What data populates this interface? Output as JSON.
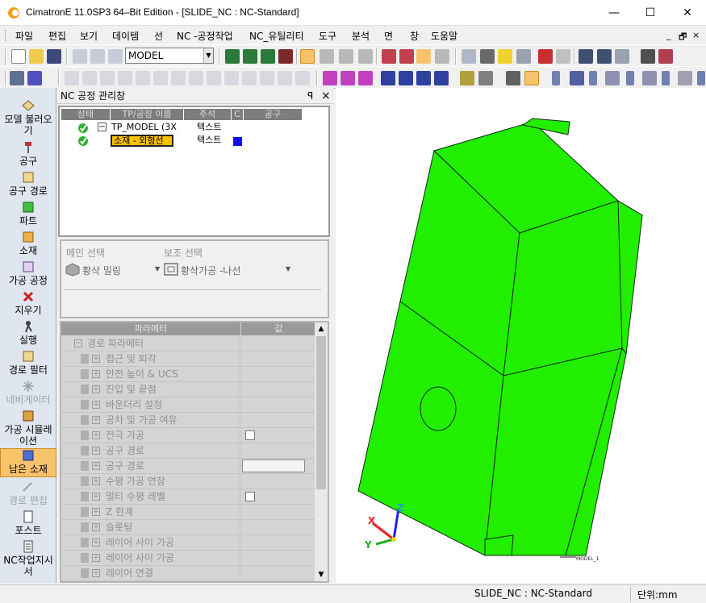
{
  "window": {
    "title": "CimatronE 11.0SP3 64–Bit Edition - [SLIDE_NC : NC-Standard]",
    "min": "—",
    "max": "☐",
    "close": "✕"
  },
  "menu": [
    "파일",
    "편집",
    "보기",
    "데이템",
    "선",
    "NC -공정작업",
    "NC_유틸리티",
    "도구",
    "분석",
    "면",
    "창",
    "도움말"
  ],
  "mdi": {
    "min": "_",
    "restore": "🗗",
    "close": "×"
  },
  "toolbar": {
    "model_combo": "MODEL"
  },
  "sidebar": {
    "items": [
      {
        "label": "모델 불러오기",
        "icon": "load-model-icon"
      },
      {
        "label": "공구",
        "icon": "tool-icon"
      },
      {
        "label": "공구 경로",
        "icon": "toolpath-icon"
      },
      {
        "label": "파트",
        "icon": "part-icon"
      },
      {
        "label": "소재",
        "icon": "stock-icon"
      },
      {
        "label": "가공 공정",
        "icon": "procedure-icon"
      },
      {
        "label": "지우기",
        "icon": "delete-icon"
      },
      {
        "label": "실행",
        "icon": "run-icon"
      },
      {
        "label": "경로 필터",
        "icon": "path-filter-icon"
      },
      {
        "label": "네비게이터",
        "icon": "navigator-icon"
      },
      {
        "label": "가공 시뮬레이션",
        "icon": "simulation-icon"
      },
      {
        "label": "남은 소재",
        "icon": "remaining-stock-icon"
      },
      {
        "label": "경로 편집",
        "icon": "edit-path-icon"
      },
      {
        "label": "포스트",
        "icon": "post-icon"
      },
      {
        "label": "NC작업지시서",
        "icon": "nc-setup-sheet-icon"
      }
    ]
  },
  "panel": {
    "title": "NC 공정 관리창",
    "pin": "ꟼ",
    "close": "×",
    "tree": {
      "headers": [
        "상태",
        "TP/공정 이름",
        "주석",
        "C",
        "공구"
      ],
      "rows": [
        {
          "name": "TP_MODEL (3X",
          "comment": "텍스트",
          "expander": "−"
        },
        {
          "name": "소재 - 외형선",
          "comment": "텍스트"
        }
      ]
    },
    "selection": {
      "main_label": "메인 선택",
      "sub_label": "보조 선택",
      "main_value": "황삭 밀링",
      "sub_value": "황삭가공 -나선"
    },
    "params": {
      "headers": [
        "파라메터",
        "값"
      ],
      "rows": [
        "경로 파라메터",
        "접근 및 퇴각",
        "안전 높이 & UCS",
        "진입 및 끝점",
        "바운더리 설정",
        "공차 및 가공 여유",
        "전극 가공",
        "공구 경로",
        "공구 경로",
        "수평 가공 연장",
        "멀티 수평 레벨",
        "Z 한계",
        "슬롯팅",
        "레이어 사이 가공",
        "레이어 사이 가공",
        "레이어 연결"
      ]
    }
  },
  "viewport": {
    "axis": {
      "x": "X",
      "y": "Y",
      "z": "Z"
    },
    "model_tag": "MODEL_1",
    "model_color": "#22ee00"
  },
  "status": {
    "doc": "SLIDE_NC : NC-Standard",
    "unit": "단위:mm"
  }
}
